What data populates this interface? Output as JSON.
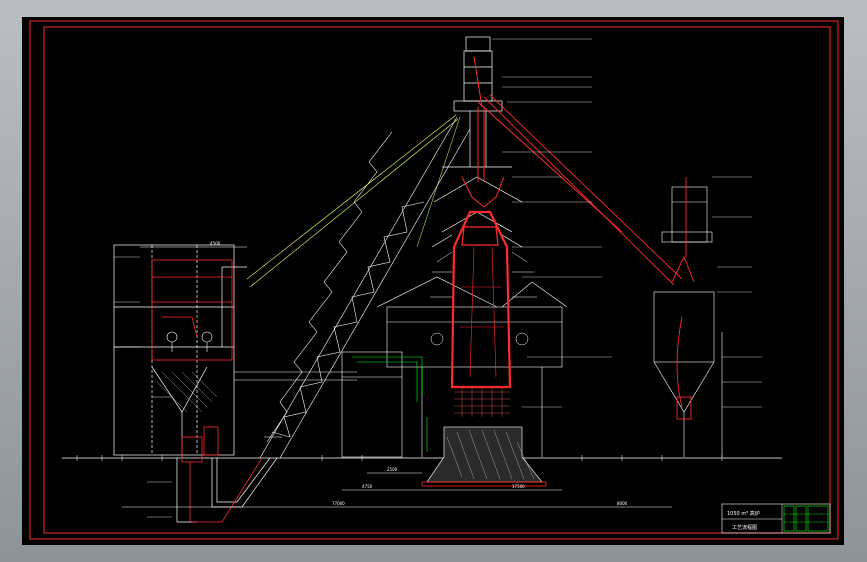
{
  "colors": {
    "background": "#000000",
    "frame": "#b0b5bb",
    "furnace": "#ff2a2a",
    "structure": "#ffffff",
    "skip_line": "#ffff66",
    "hatch": "#cfcfcf",
    "title_block": "#00ff00"
  },
  "dimensions": {
    "left_span": "77000",
    "right_span": "8000",
    "mid_span": "17500",
    "span_a": "4750",
    "span_b": "2500",
    "top_width": "4500"
  },
  "title_block": {
    "line1": "1050 m³ 高炉",
    "line2": "工艺流程图"
  }
}
